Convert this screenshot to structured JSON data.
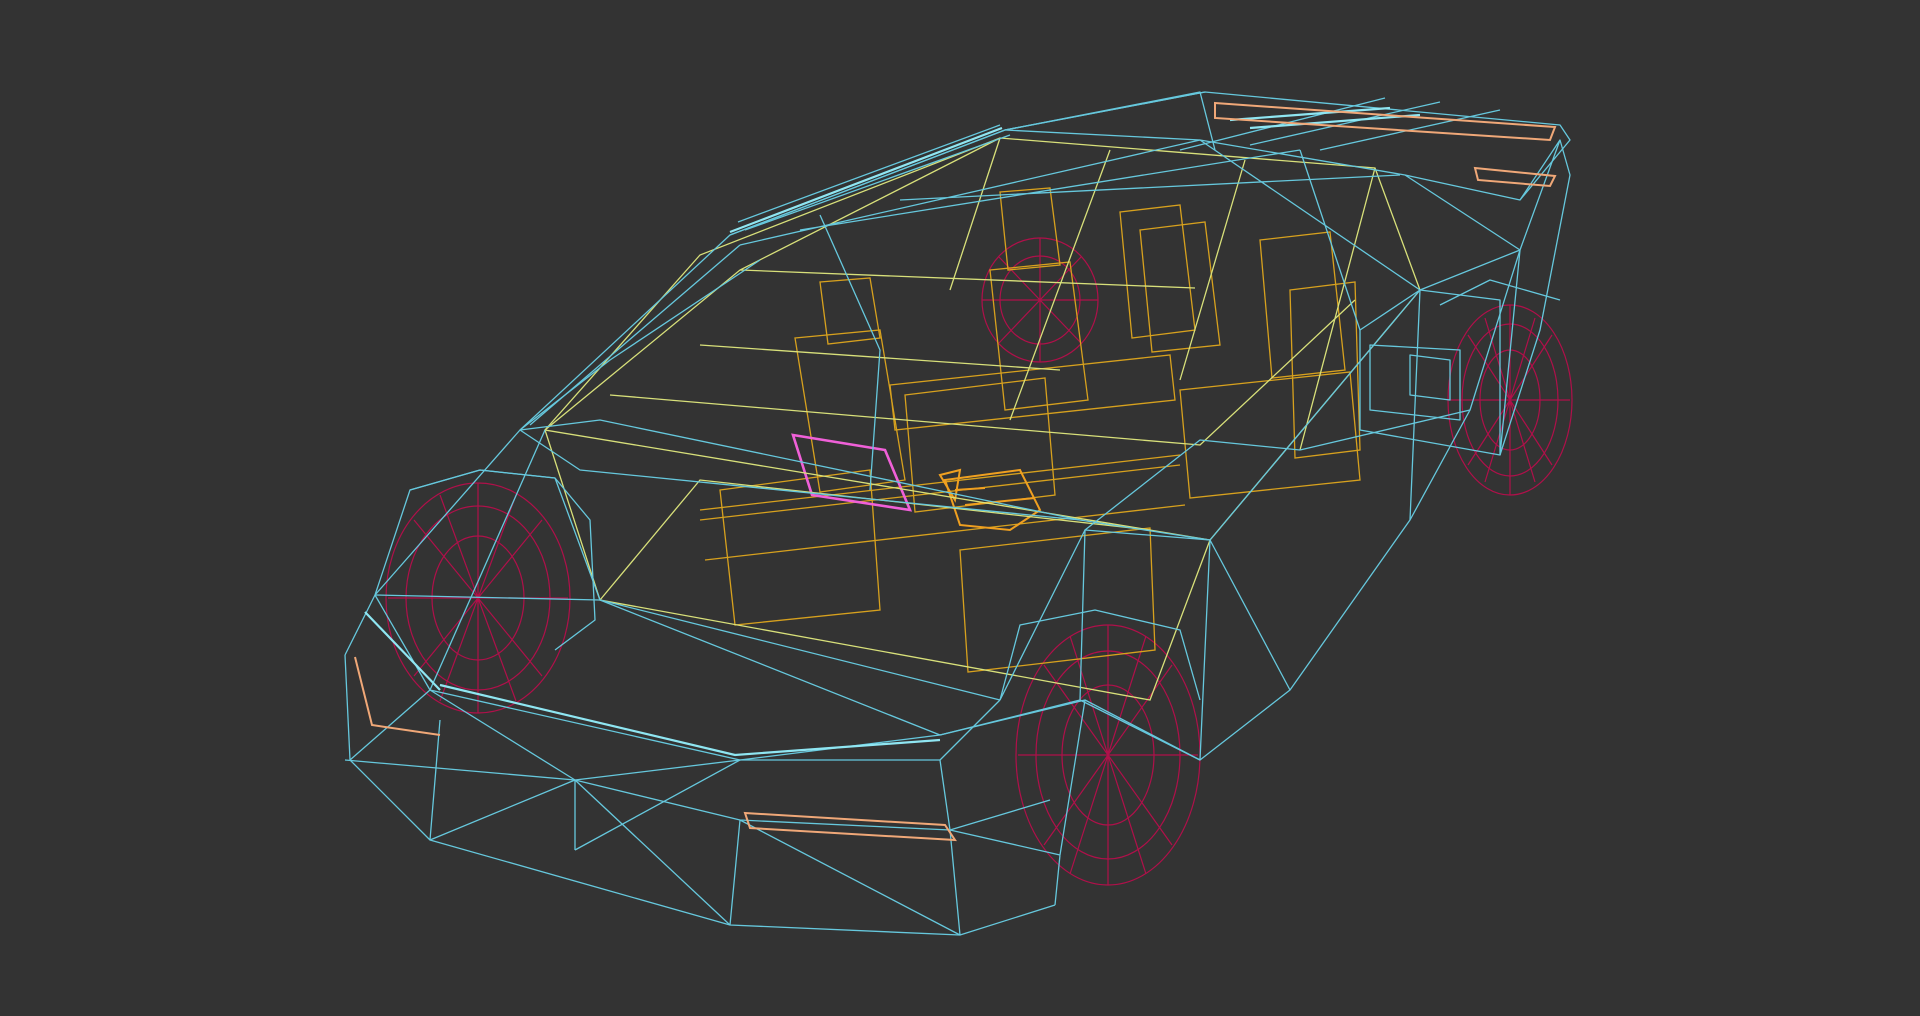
{
  "viewport": {
    "background": "#333333",
    "render_mode": "wireframe"
  },
  "model": {
    "subject": "car",
    "colors": {
      "body": "#66c8dd",
      "body_highlight": "#8fe6f2",
      "glass": "#d8e07a",
      "interior": "#d7a11e",
      "wheels": "#b0104a",
      "dash_screen": "#f060d8",
      "lights": "#f0a878"
    }
  }
}
